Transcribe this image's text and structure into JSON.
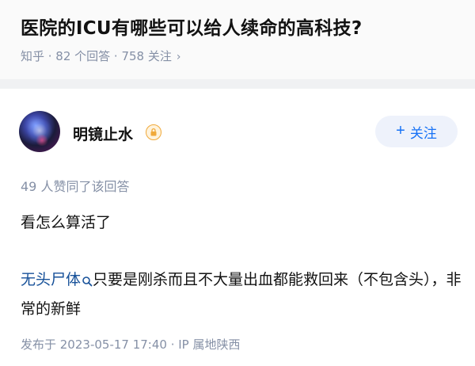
{
  "question": {
    "title": "医院的ICU有哪些可以给人续命的高科技?",
    "meta": "知乎 · 82 个回答 · 758 关注",
    "meta_chevron": "›"
  },
  "author": {
    "name": "明镜止水",
    "avatar_icon": "avatar-image",
    "badge_icon": "lock-badge-icon",
    "follow_label": "关注",
    "follow_plus": "+"
  },
  "answer": {
    "vote_text": "49 人赞同了该回答",
    "line1": "看怎么算活了",
    "link_term": "无头尸体",
    "search_icon": "search-icon",
    "paragraph_rest": "只要是刚杀而且不大量出血都能救回来（不包含头），非常的新鲜",
    "published": "发布于 2023-05-17 17:40 · IP 属地陕西"
  },
  "colors": {
    "accent": "#1772f6",
    "link": "#175199",
    "meta_gray": "#8590a6",
    "follow_bg": "#eef2fb",
    "badge": "#f0a93a"
  }
}
